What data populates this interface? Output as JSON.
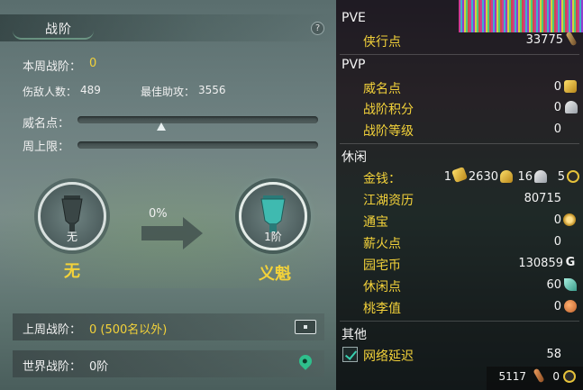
{
  "left_panel": {
    "title": "战阶",
    "help": "?",
    "weekly_rank_label": "本周战阶：",
    "weekly_rank_value": "0",
    "kills_label": "伤敌人数：",
    "kills_value": "489",
    "assists_label": "最佳助攻：",
    "assists_value": "3556",
    "prestige_label": "威名点：",
    "prestige_fill": 0.35,
    "weekly_cap_label": "周上限：",
    "weekly_cap_fill": 0.0,
    "current_rank": {
      "caption": "无",
      "name": "无"
    },
    "progress": "0%",
    "next_rank": {
      "caption": "1阶",
      "name": "义魁"
    },
    "last_week_label": "上周战阶：",
    "last_week_value": "0 (500名以外)",
    "world_rank_label": "世界战阶：",
    "world_rank_value": "0阶"
  },
  "right_panel": {
    "pve": {
      "header": "PVE",
      "items": [
        {
          "label": "侠行点",
          "value": "33775",
          "icon": "scroll-icon"
        }
      ]
    },
    "pvp": {
      "header": "PVP",
      "items": [
        {
          "label": "威名点",
          "value": "0",
          "icon": "gold-ingot-icon"
        },
        {
          "label": "战阶积分",
          "value": "0",
          "icon": "silver-crest-icon"
        },
        {
          "label": "战阶等级",
          "value": "0",
          "icon": ""
        }
      ]
    },
    "leisure": {
      "header": "休闲",
      "money_label": "金钱：",
      "money": {
        "gold": "1",
        "ingot": "2630",
        "silver": "16",
        "copper": "5"
      },
      "items": [
        {
          "label": "江湖资历",
          "value": "80715",
          "icon": ""
        },
        {
          "label": "通宝",
          "value": "0",
          "icon": "coin-icon"
        },
        {
          "label": "薪火点",
          "value": "0",
          "icon": ""
        },
        {
          "label": "园宅币",
          "value": "130859",
          "icon": "g-icon"
        },
        {
          "label": "休闲点",
          "value": "60",
          "icon": "feather-icon"
        },
        {
          "label": "桃李值",
          "value": "0",
          "icon": "peach-icon"
        }
      ]
    },
    "other": {
      "header": "其他",
      "items": [
        {
          "label": "网络延迟",
          "value": "58",
          "checked": true
        }
      ]
    },
    "footer": {
      "left_value": "5117",
      "right_value": "0"
    }
  }
}
